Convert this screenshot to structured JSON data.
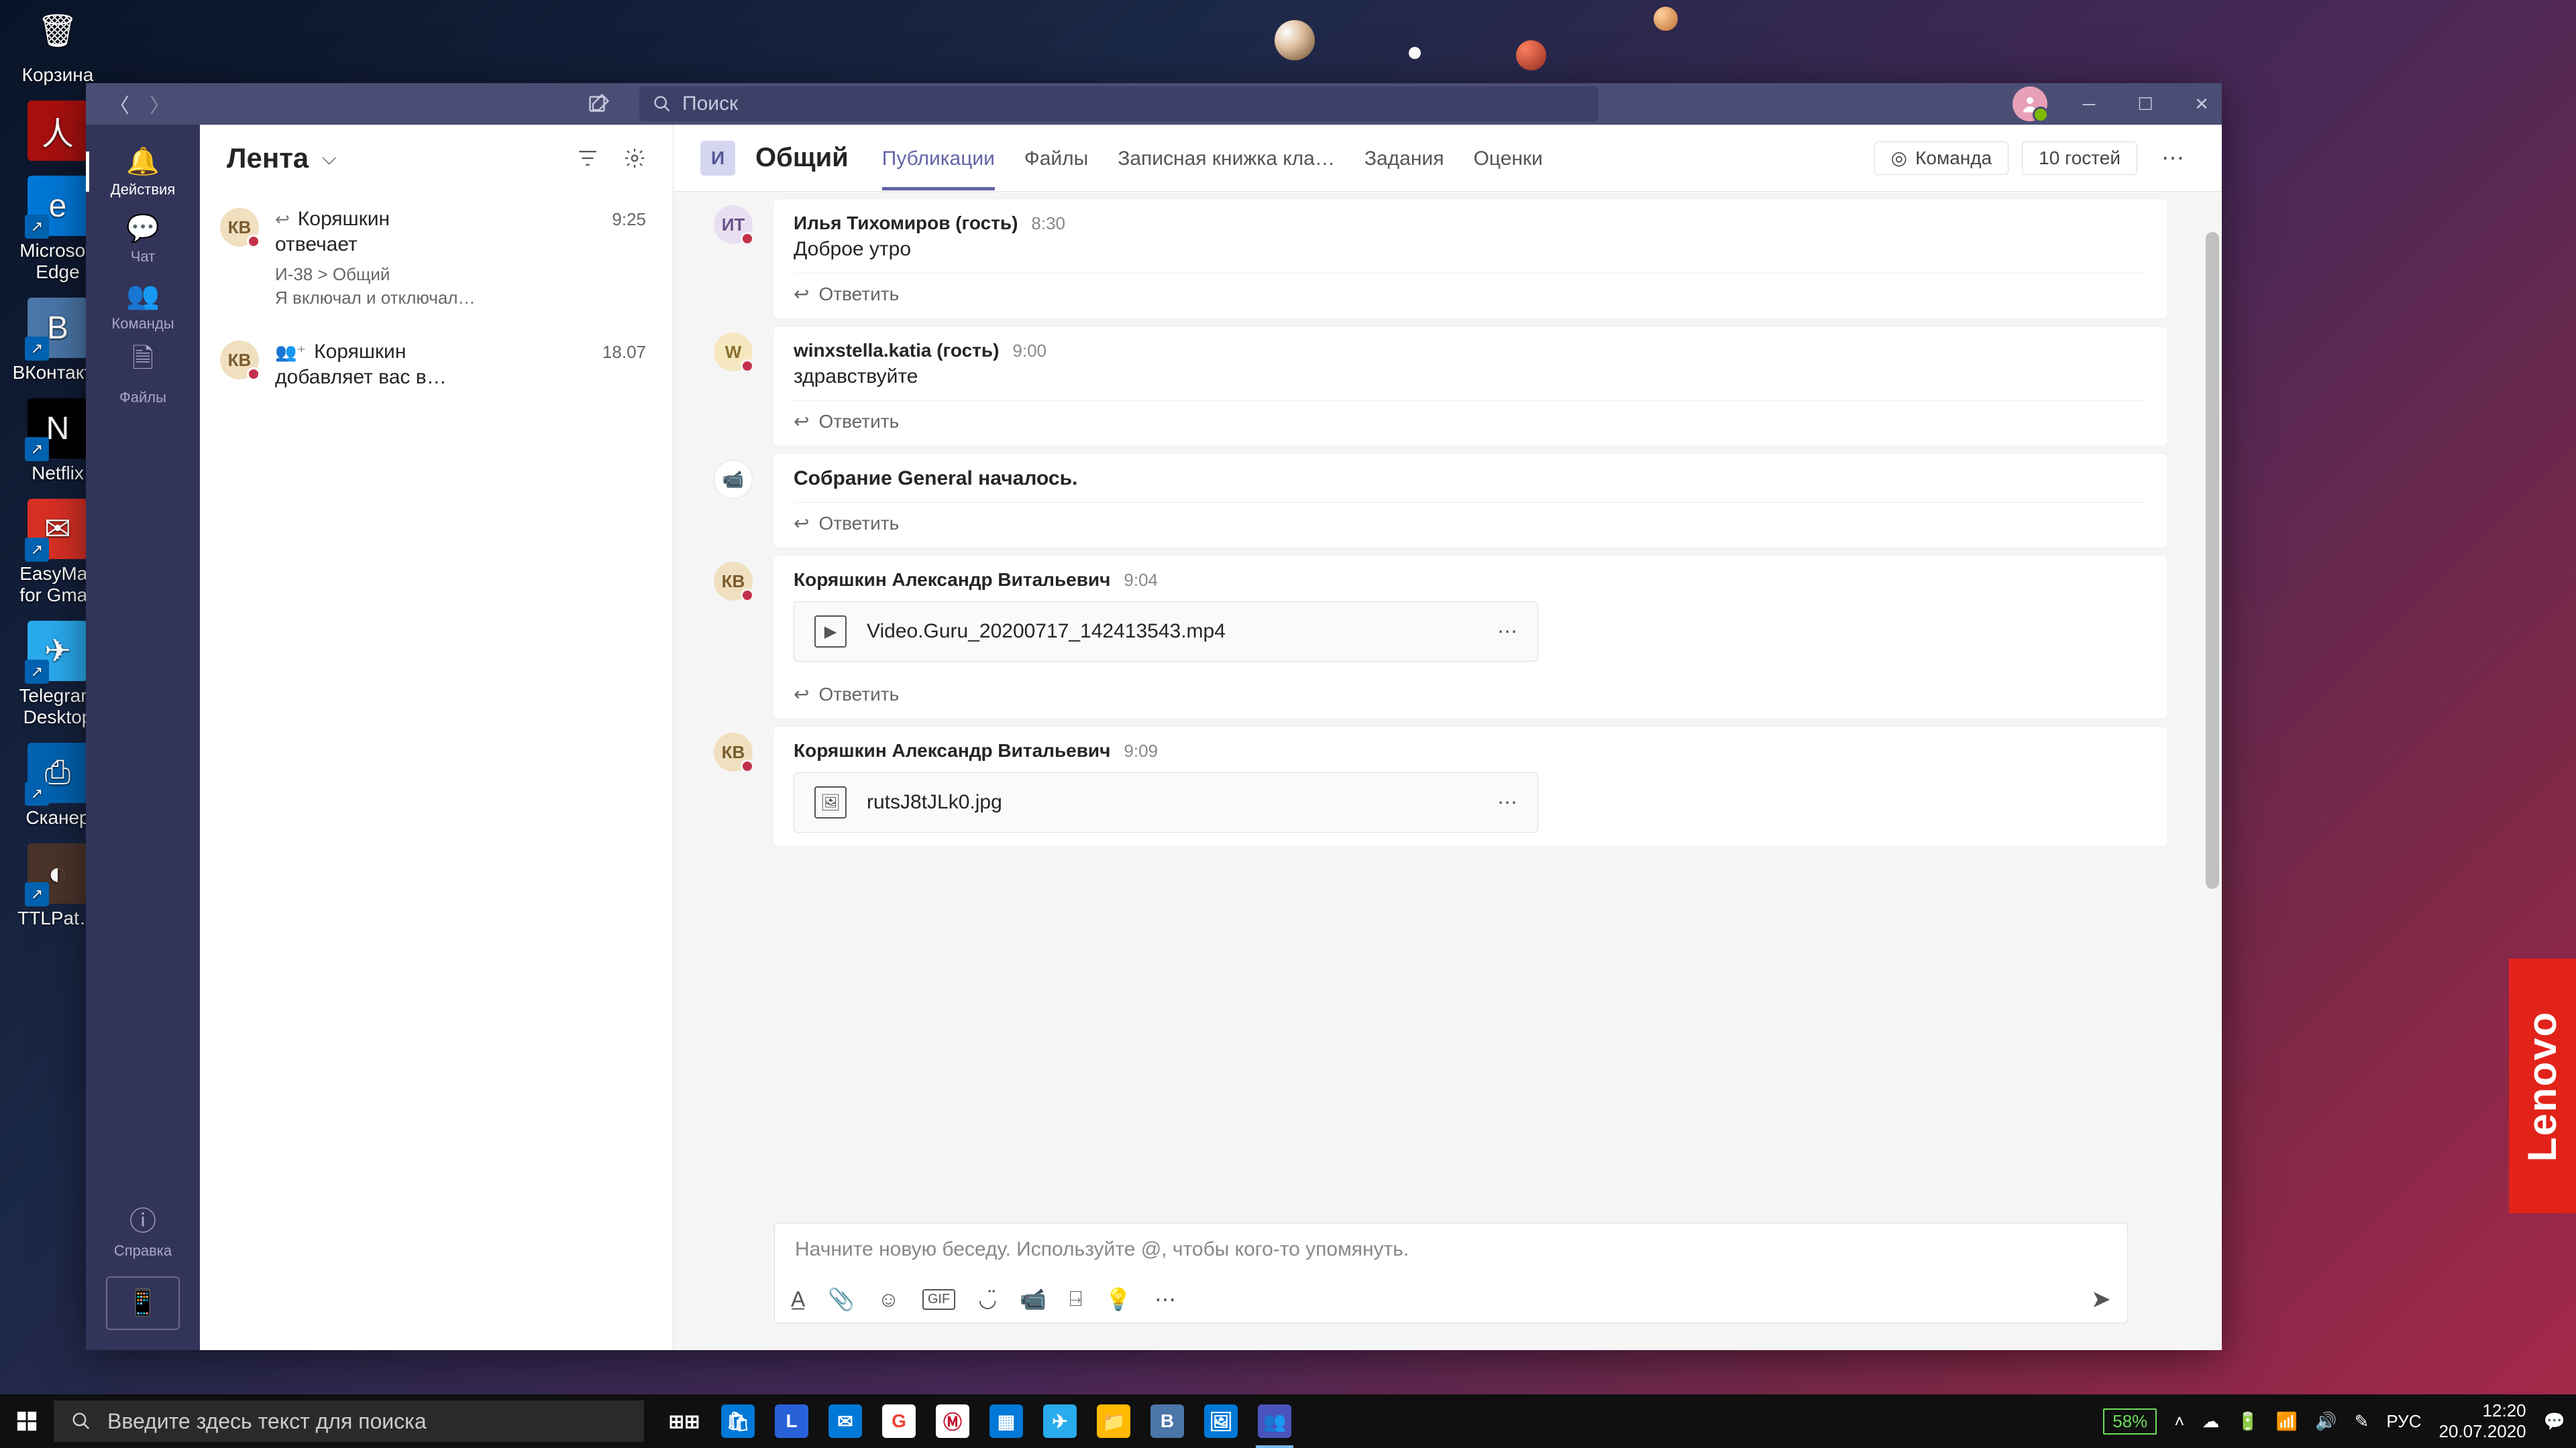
{
  "desktop_icons": [
    {
      "label": "Корзина",
      "bg": "transparent",
      "emoji": "🗑"
    },
    {
      "label": "",
      "bg": "#a8100f",
      "emoji": "人"
    },
    {
      "label": "Microsoft Edge",
      "bg": "#0078d7",
      "emoji": "e"
    },
    {
      "label": "ВКонтакте",
      "bg": "#4a76a8",
      "emoji": "B"
    },
    {
      "label": "Netflix",
      "bg": "#000",
      "emoji": "N"
    },
    {
      "label": "EasyMail for Gmail",
      "bg": "#d93025",
      "emoji": "✉"
    },
    {
      "label": "Telegram Desktop",
      "bg": "#2aabee",
      "emoji": "✈"
    },
    {
      "label": "Сканер",
      "bg": "#0063b1",
      "emoji": "⎙"
    },
    {
      "label": "TTLPat…",
      "bg": "#4a342a",
      "emoji": "◐"
    }
  ],
  "lenovo": "Lenovo",
  "titlebar": {
    "search_placeholder": "Поиск"
  },
  "rail": [
    "Действия",
    "Чат",
    "Команды",
    "Файлы"
  ],
  "rail_help": "Справка",
  "feed": {
    "title": "Лента",
    "items": [
      {
        "name": "Коряшкин",
        "action": "отвечает",
        "time": "9:25",
        "channel": "И-38 > Общий",
        "preview": "Я включал и отключал…",
        "prefix": "↩"
      },
      {
        "name": "Коряшкин",
        "action": "добавляет вас в…",
        "time": "18.07",
        "channel": "",
        "preview": "",
        "prefix": "👥⁺"
      }
    ]
  },
  "channel": {
    "team_initial": "И",
    "name": "Общий",
    "tabs": [
      "Публикации",
      "Файлы",
      "Записная книжка кла…",
      "Задания",
      "Оценки"
    ],
    "team_btn": "Команда",
    "guests": "10 гостей"
  },
  "messages": [
    {
      "avatar": "ИТ",
      "avcls": "av-it",
      "author": "Илья Тихомиров (гость)",
      "time": "8:30",
      "text": "Доброе утро",
      "reply": "Ответить"
    },
    {
      "avatar": "W",
      "avcls": "av-w",
      "author": "winxstella.katia (гость)",
      "time": "9:00",
      "text": "здравствуйте",
      "reply": "Ответить"
    },
    {
      "meeting": true,
      "text": "Собрание General началось.",
      "reply": "Ответить"
    },
    {
      "avatar": "КВ",
      "avcls": "av-kv",
      "author": "Коряшкин Александр Витальевич",
      "time": "9:04",
      "attachment": "Video.Guru_20200717_142413543.mp4",
      "att_icon": "▶",
      "reply": "Ответить"
    },
    {
      "avatar": "КВ",
      "avcls": "av-kv",
      "author": "Коряшкин Александр Витальевич",
      "time": "9:09",
      "attachment": "rutsJ8tJLk0.jpg",
      "att_icon": "🖼",
      "reply": ""
    }
  ],
  "composer": {
    "placeholder": "Начните новую беседу. Используйте @, чтобы кого-то упомянуть."
  },
  "taskbar": {
    "search_placeholder": "Введите здесь текст для поиска",
    "apps": [
      {
        "bg": "transparent",
        "txt": "⊞⊞",
        "color": "#fff"
      },
      {
        "bg": "#0078d7",
        "txt": "🛍",
        "color": "#fff"
      },
      {
        "bg": "#2961d9",
        "txt": "L",
        "color": "#fff"
      },
      {
        "bg": "#0078d7",
        "txt": "✉",
        "color": "#fff"
      },
      {
        "bg": "#fff",
        "txt": "G",
        "color": "#ea4335"
      },
      {
        "bg": "#fff",
        "txt": "Ⓜ",
        "color": "#c4122e"
      },
      {
        "bg": "#0078d7",
        "txt": "▦",
        "color": "#fff"
      },
      {
        "bg": "#2aabee",
        "txt": "✈",
        "color": "#fff"
      },
      {
        "bg": "#ffb900",
        "txt": "📁",
        "color": "#fff"
      },
      {
        "bg": "#4a76a8",
        "txt": "B",
        "color": "#fff"
      },
      {
        "bg": "#0078d7",
        "txt": "🖼",
        "color": "#fff"
      },
      {
        "bg": "#4b53bc",
        "txt": "👥",
        "color": "#fff",
        "active": true
      }
    ],
    "battery": "58%",
    "lang": "РУС",
    "time": "12:20",
    "date": "20.07.2020"
  }
}
